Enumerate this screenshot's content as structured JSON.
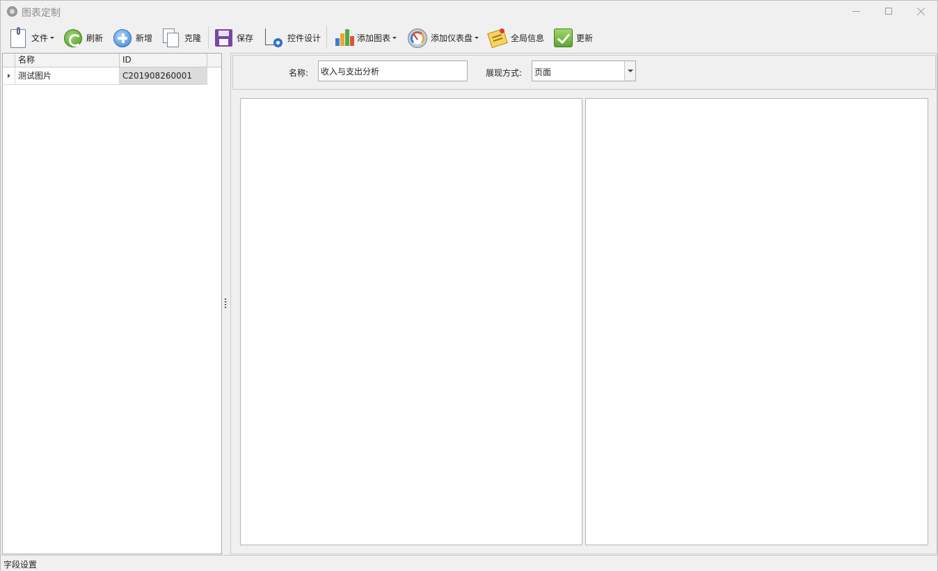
{
  "window": {
    "title": "图表定制"
  },
  "toolbar": {
    "file_label": "文件",
    "refresh_label": "刷新",
    "add_label": "新增",
    "clone_label": "克隆",
    "save_label": "保存",
    "design_label": "控件设计",
    "add_chart_label": "添加图表",
    "add_gauge_label": "添加仪表盘",
    "global_info_label": "全局信息",
    "update_label": "更新"
  },
  "grid": {
    "columns": [
      "名称",
      "ID"
    ],
    "rows": [
      {
        "name": "测试图片",
        "id": "C201908260001"
      }
    ]
  },
  "form": {
    "name_label": "名称:",
    "name_value": "收入与支出分析",
    "display_label": "展现方式:",
    "display_value": "页面"
  },
  "status": {
    "text": "字段设置"
  }
}
